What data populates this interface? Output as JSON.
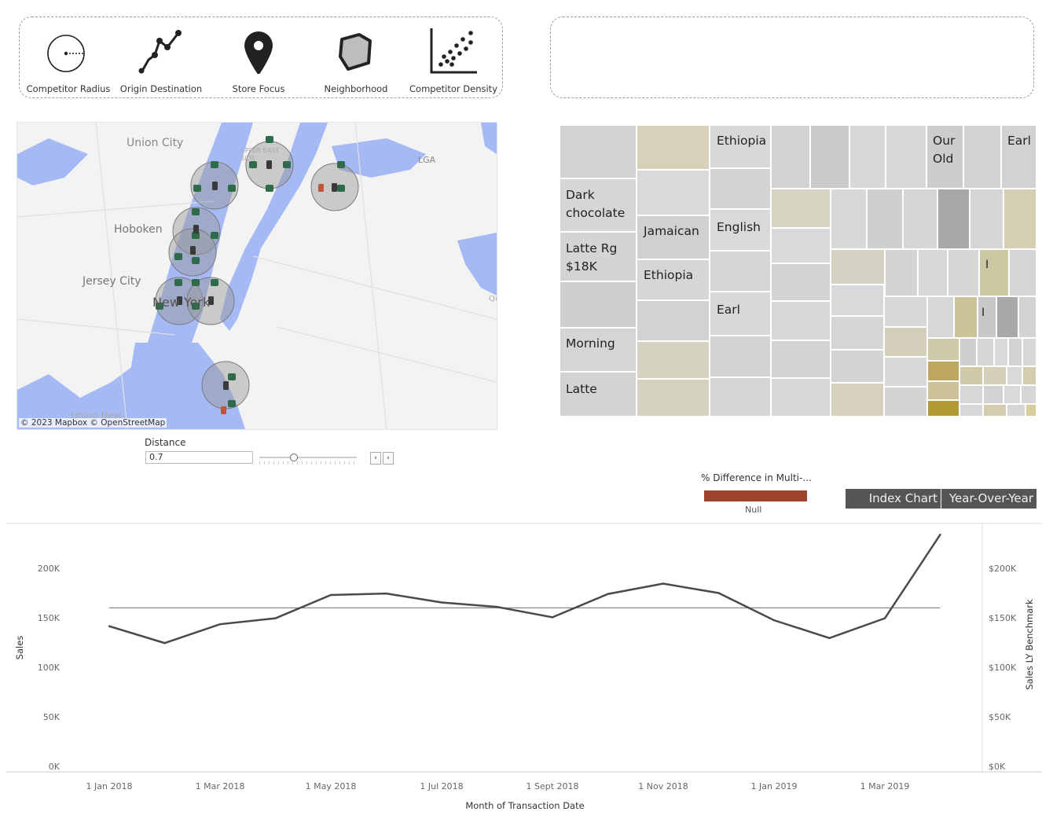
{
  "toolbar": {
    "tools": [
      {
        "label": "Competitor Radius",
        "icon": "radius-icon"
      },
      {
        "label": "Origin Destination",
        "icon": "route-icon"
      },
      {
        "label": "Store Focus",
        "icon": "map-pin-icon"
      },
      {
        "label": "Neighborhood",
        "icon": "polygon-icon"
      },
      {
        "label": "Competitor Density",
        "icon": "scatter-icon"
      }
    ]
  },
  "map": {
    "labels": {
      "union_city": "Union City",
      "hoboken": "Hoboken",
      "jersey_city": "Jersey City",
      "new_york": "New York",
      "lga": "LGA",
      "upper_east_side": "UPPER EAST SIDE",
      "union_new": "Union New",
      "queens_edge": "Qu"
    },
    "attribution": "© 2023 Mapbox  © OpenStreetMap",
    "colors": {
      "water": "#a5b9f5",
      "land": "#f3f3f3",
      "circle": "#9a9a9a",
      "store": "#2e6b4a",
      "competitor": "#3a3a3a"
    }
  },
  "treemap": {
    "labels": [
      "Ethiopia",
      "Our",
      "Old",
      "Earl",
      "Dark",
      "chocolate",
      "Jamaican",
      "English",
      "Latte Rg",
      "$18K",
      "Ethiopia",
      "I",
      "Earl",
      "I",
      "Morning",
      "Latte"
    ]
  },
  "distance": {
    "title": "Distance",
    "value": "0.7",
    "prev": "‹",
    "next": "›"
  },
  "legend": {
    "title": "% Difference in Multi-...",
    "null_label": "Null",
    "color": "#a0432b"
  },
  "toggles": {
    "index_chart": "Index Chart",
    "year_over_year": "Year-Over-Year"
  },
  "chart_data": {
    "type": "line",
    "x": [
      "Jan 2018",
      "Feb 2018",
      "Mar 2018",
      "Apr 2018",
      "May 2018",
      "Jun 2018",
      "Jul 2018",
      "Aug 2018",
      "Sep 2018",
      "Oct 2018",
      "Nov 2018",
      "Dec 2018",
      "Jan 2019",
      "Feb 2019",
      "Mar 2019",
      "Apr 2019"
    ],
    "series": [
      {
        "name": "",
        "values": [
          141500,
          124500,
          143500,
          149500,
          173000,
          174500,
          165500,
          161000,
          150500,
          174000,
          184500,
          175000,
          147500,
          129500,
          149500,
          234000
        ]
      }
    ],
    "benchmark": 160000,
    "xticks": [
      "1 Jan 2018",
      "1 Mar 2018",
      "1 May 2018",
      "1 Jul 2018",
      "1 Sept 2018",
      "1 Nov 2018",
      "1 Jan 2019",
      "1 Mar 2019"
    ],
    "yticks_left": [
      "0K",
      "50K",
      "100K",
      "150K",
      "200K"
    ],
    "yticks_right": [
      "$0K",
      "$50K",
      "$100K",
      "$150K",
      "$200K"
    ],
    "ylim": [
      0,
      250000
    ],
    "xlabel": "Month of Transaction Date",
    "ylabel": "Sales",
    "ylabel_right": "Sales LY Benchmark",
    "line_color": "#4a4a4a",
    "benchmark_color": "#888888"
  }
}
